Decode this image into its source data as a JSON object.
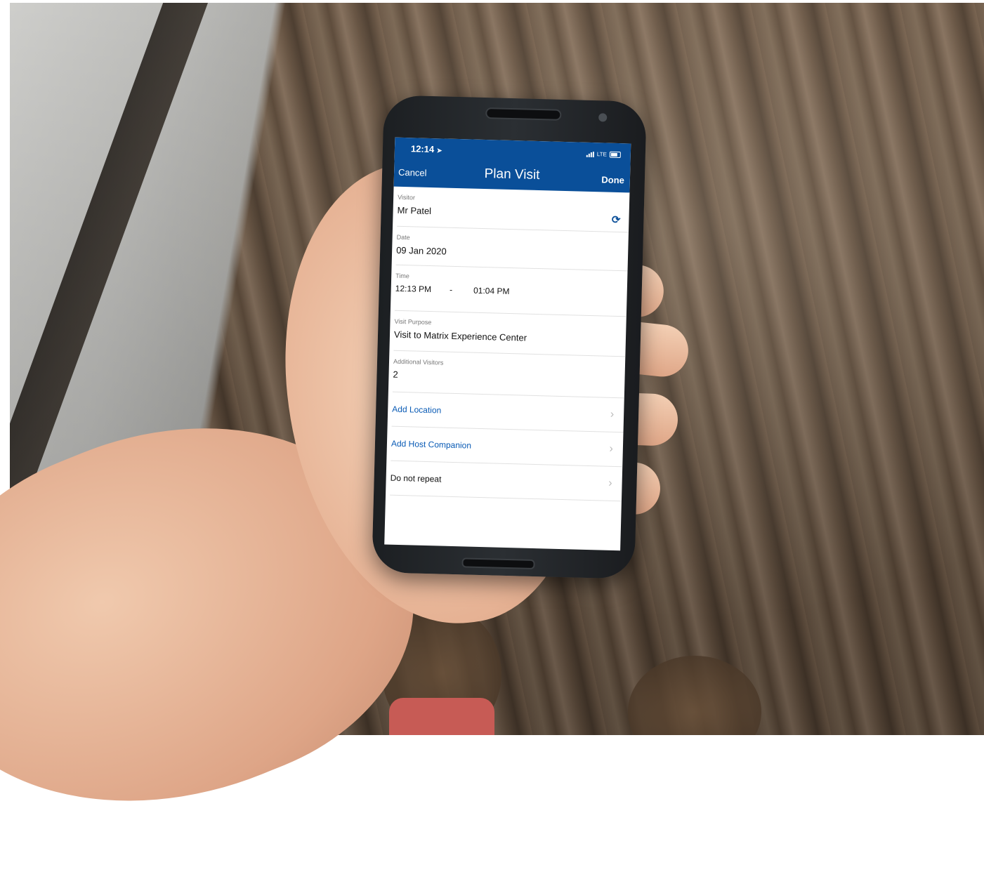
{
  "status_bar": {
    "time": "12:14",
    "location_glyph": "➤",
    "network": "LTE"
  },
  "nav": {
    "cancel": "Cancel",
    "title": "Plan Visit",
    "done": "Done"
  },
  "form": {
    "visitor": {
      "label": "Visitor",
      "value": "Mr Patel"
    },
    "date": {
      "label": "Date",
      "value": "09 Jan 2020"
    },
    "time": {
      "label": "Time",
      "start": "12:13 PM",
      "separator": "-",
      "end": "01:04 PM"
    },
    "purpose": {
      "label": "Visit Purpose",
      "value": "Visit to Matrix Experience Center"
    },
    "additional_visitors": {
      "label": "Additional Visitors",
      "value": "2"
    }
  },
  "rows": {
    "add_location": "Add Location",
    "add_host": "Add Host Companion",
    "repeat": "Do not repeat"
  },
  "icons": {
    "refresh": "refresh-icon",
    "chevron": "chevron-right-icon"
  },
  "colors": {
    "nav_bg": "#0a4f99",
    "link": "#0a5bb5"
  }
}
